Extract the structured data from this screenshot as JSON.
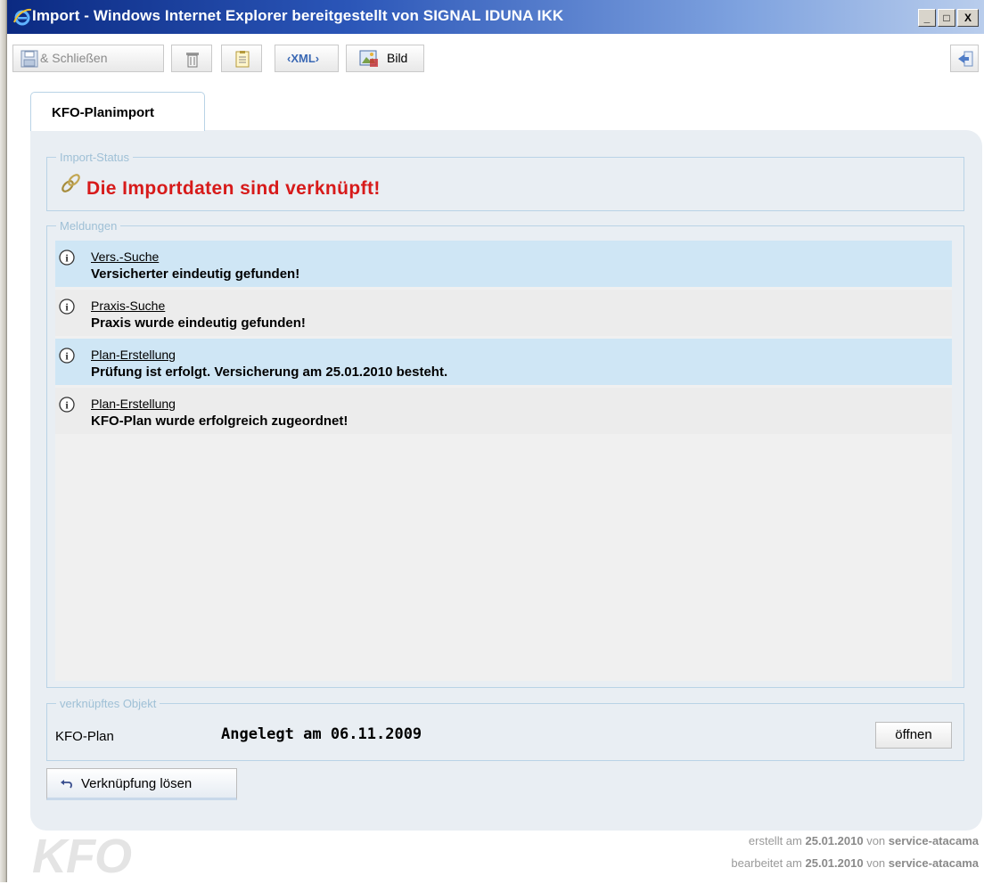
{
  "window": {
    "title": "Import - Windows Internet Explorer bereitgestellt von SIGNAL IDUNA IKK",
    "minimize": "_",
    "maximize": "□",
    "close": "X"
  },
  "toolbar": {
    "save_close_label": "& Schließen",
    "bild_label": "Bild",
    "xml_label": "‹XML›"
  },
  "tab": {
    "label": "KFO-Planimport"
  },
  "import_status": {
    "legend": "Import-Status",
    "message": "Die Importdaten sind verknüpft!"
  },
  "meldungen": {
    "legend": "Meldungen",
    "items": [
      {
        "link": "Vers.-Suche",
        "text": "Versicherter eindeutig gefunden!"
      },
      {
        "link": "Praxis-Suche",
        "text": "Praxis wurde eindeutig gefunden!"
      },
      {
        "link": "Plan-Erstellung",
        "text": "Prüfung ist erfolgt. Versicherung am 25.01.2010 besteht."
      },
      {
        "link": "Plan-Erstellung",
        "text": "KFO-Plan wurde erfolgreich zugeordnet!"
      }
    ]
  },
  "linked_object": {
    "legend": "verknüpftes Objekt",
    "type": "KFO-Plan",
    "created": "Angelegt am 06.11.2009",
    "open_label": "öffnen"
  },
  "unlink_label": "Verknüpfung lösen",
  "footer": {
    "watermark": "KFO",
    "created_prefix": "erstellt am",
    "created_date": "25.01.2010",
    "created_by_prefix": "von",
    "created_by": "service-atacama",
    "edited_prefix": "bearbeitet am",
    "edited_date": "25.01.2010",
    "edited_by_prefix": "von",
    "edited_by": "service-atacama"
  },
  "colors": {
    "status_red": "#d71a1a",
    "row_highlight": "#cfe6f5",
    "row_plain": "#ececec",
    "panel_bg": "#e9eef3",
    "titlebar_dark": "#0b2a82"
  }
}
